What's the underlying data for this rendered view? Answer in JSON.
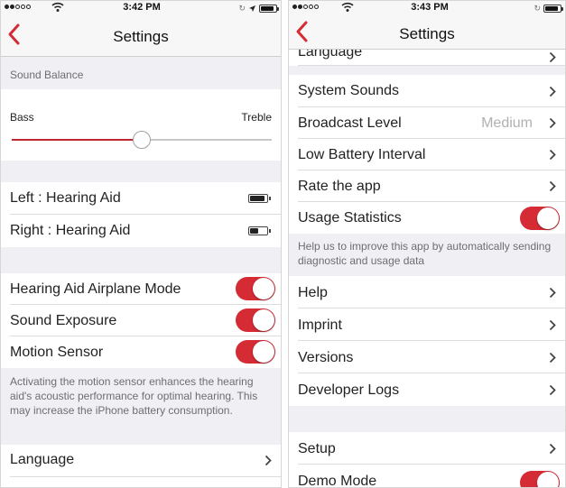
{
  "theme": {
    "accent": "#d52b34",
    "group_background": "#efeff4",
    "cell_background": "#ffffff"
  },
  "left": {
    "status": {
      "signal_dots": 2,
      "time": "3:42 PM",
      "battery_level": 0.9
    },
    "nav": {
      "title": "Settings",
      "back_icon": "chevron-left-icon"
    },
    "sound_balance": {
      "header": "Sound Balance",
      "min_label": "Bass",
      "max_label": "Treble",
      "value": 0.5
    },
    "hearing_aids": [
      {
        "label": "Left   : Hearing Aid",
        "battery_level": 0.9
      },
      {
        "label": "Right : Hearing Aid",
        "battery_level": 0.55
      }
    ],
    "toggles": [
      {
        "label": "Hearing Aid Airplane Mode",
        "on": true
      },
      {
        "label": "Sound Exposure",
        "on": true
      },
      {
        "label": "Motion Sensor",
        "on": true
      }
    ],
    "motion_footnote": "Activating the motion sensor enhances the hearing aid's acoustic performance for optimal hearing. This may increase the iPhone battery consumption.",
    "language_label": "Language"
  },
  "right": {
    "status": {
      "signal_dots": 2,
      "time": "3:43 PM",
      "battery_level": 0.9
    },
    "nav": {
      "title": "Settings",
      "back_icon": "chevron-left-icon"
    },
    "rows": {
      "language": "Language",
      "system_sounds": "System Sounds",
      "broadcast_level": "Broadcast Level",
      "broadcast_value": "Medium",
      "low_battery": "Low Battery Interval",
      "rate_app": "Rate the app",
      "usage_statistics": "Usage Statistics",
      "usage_on": true,
      "usage_footnote": "Help us to improve this app by automatically sending diagnostic and usage data",
      "help": "Help",
      "imprint": "Imprint",
      "versions": "Versions",
      "developer_logs": "Developer Logs",
      "setup": "Setup",
      "demo_mode": "Demo Mode",
      "demo_on": true
    }
  }
}
